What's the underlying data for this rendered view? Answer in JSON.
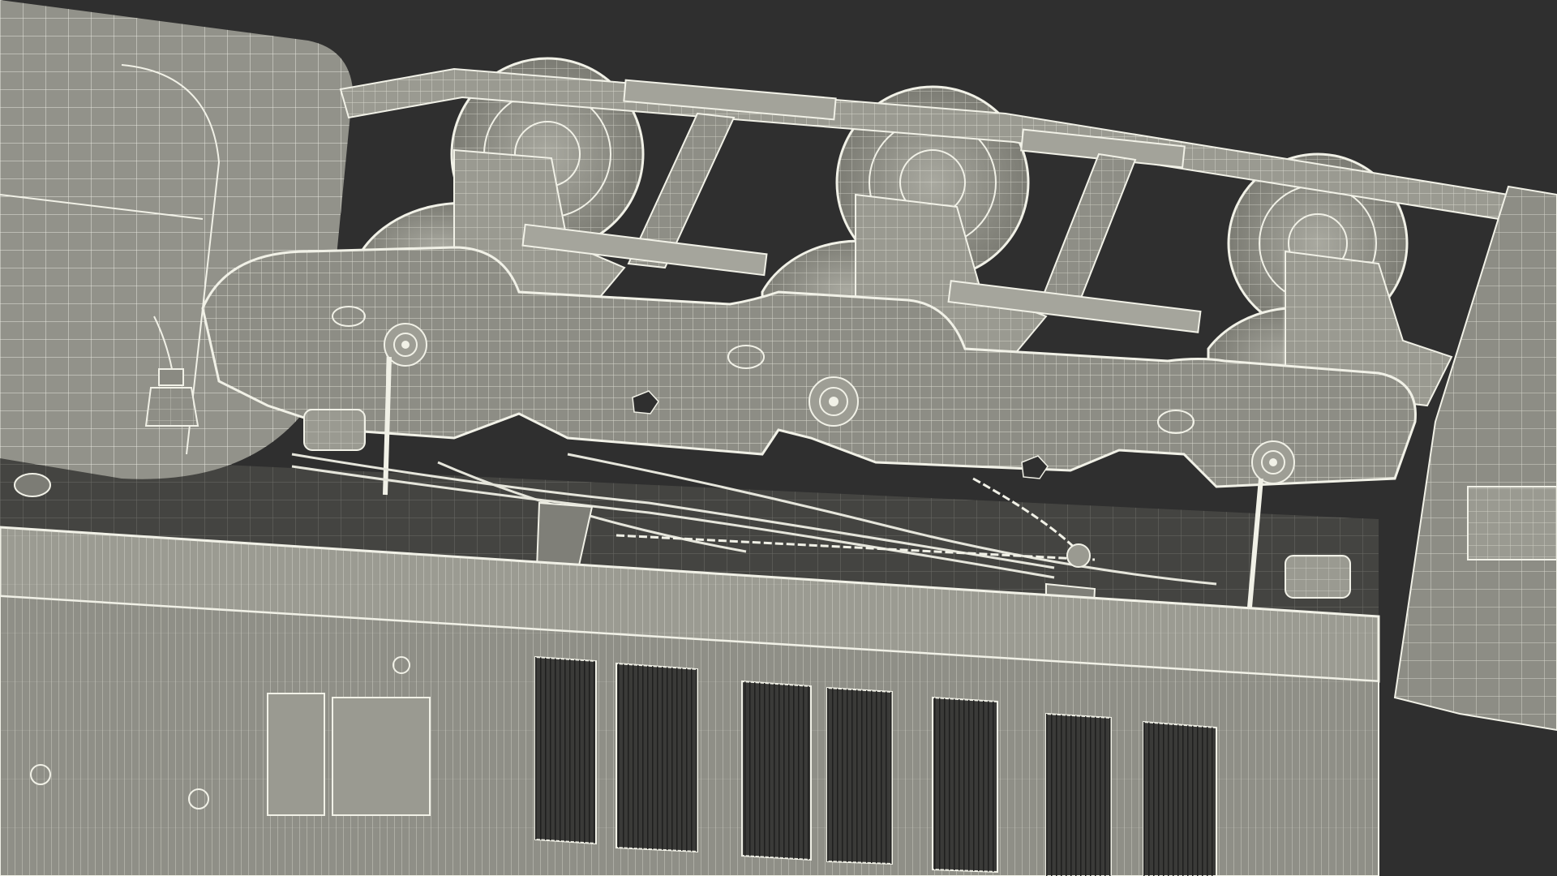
{
  "scene": {
    "subject": "locomotive-bogie-wireframe-render",
    "colors": {
      "background": "#2f2f2f",
      "shade": "#8f8f87",
      "shade_dark": "#6f6f69",
      "shade_light": "#a9a9a0",
      "wire": "#f1f1e7",
      "wire_dim": "#d8d8ce",
      "grille": "#3a3a38",
      "floor": "#4a4a47"
    },
    "wheel_count": 6,
    "grille_panel_count": 7
  }
}
